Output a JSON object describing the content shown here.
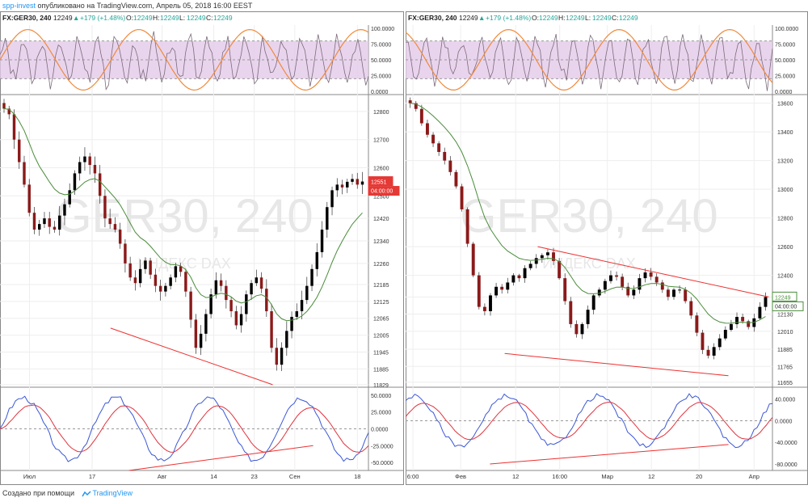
{
  "header": {
    "user": "spp-invest",
    "published": " опубликовано на TradingView.com, Апрель 05, 2018 16:00 EEST"
  },
  "footer": {
    "created": "Создано при помощи",
    "brand": "TradingView"
  },
  "colors": {
    "bull": "#000000",
    "bear": "#8b1a1a",
    "ma": "#4a8c3a",
    "stochK": "#7b6b7b",
    "stochD": "#f08a3a",
    "macd": "#3b57d6",
    "signal": "#e0333d",
    "trend": "#ee3030",
    "band": "#e3c9e8",
    "watermark": "#e7e7e7",
    "priceTag": "#e53935",
    "priceTag2": "#4a8c3a"
  },
  "charts": [
    {
      "symbol": "FX:GER30, 240",
      "quote": {
        "o": "12249",
        "h": "12249",
        "l": "12249",
        "c": "12249",
        "change": "+179 (+1.48%)"
      },
      "watermark": "GER30, 240",
      "watermark2": "ИНДЕКС DAX",
      "price_labels": [
        "12800",
        "12700",
        "12600",
        "12500",
        "12420",
        "12340",
        "12260",
        "12185",
        "12125",
        "12065",
        "12005",
        "11945",
        "11885",
        "11829"
      ],
      "price_values": [
        12800,
        12700,
        12600,
        12500,
        12420,
        12340,
        12260,
        12185,
        12125,
        12065,
        12005,
        11945,
        11885,
        11829
      ],
      "stoch_labels": [
        "100.0000",
        "75.0000",
        "50.0000",
        "25.0000",
        "0.0000"
      ],
      "macd_labels": [
        "50.0000",
        "25.0000",
        "0.0000",
        "-25.0000",
        "-50.0000"
      ],
      "macd_values": [
        50,
        25,
        0,
        -25,
        -50
      ],
      "macd_range": [
        -62,
        62
      ],
      "time_labels": [
        "Июл",
        "17",
        "Авг",
        "14",
        "23",
        "Сен",
        "18"
      ],
      "time_pos": [
        0.08,
        0.25,
        0.44,
        0.58,
        0.69,
        0.8,
        0.97
      ],
      "last_price": "12551",
      "last_value": 12551,
      "countdown": "04:00:00",
      "price_range": [
        11820,
        12860
      ],
      "closes": [
        12810,
        12790,
        12700,
        12620,
        12540,
        12440,
        12380,
        12400,
        12420,
        12390,
        12380,
        12430,
        12470,
        12520,
        12580,
        12620,
        12640,
        12610,
        12580,
        12500,
        12420,
        12400,
        12380,
        12330,
        12260,
        12210,
        12190,
        12240,
        12270,
        12220,
        12180,
        12160,
        12180,
        12210,
        12250,
        12230,
        12160,
        12060,
        11960,
        12010,
        12080,
        12150,
        12200,
        12180,
        12130,
        12090,
        12040,
        12080,
        12150,
        12190,
        12210,
        12170,
        12090,
        11960,
        11900,
        11960,
        12020,
        12070,
        12090,
        12130,
        12180,
        12240,
        12300,
        12380,
        12460,
        12520,
        12540,
        12530,
        12550,
        12560,
        12540,
        12551
      ],
      "price_trend": [
        [
          12030,
          0.3
        ],
        [
          11829,
          0.74
        ]
      ],
      "macd_trend": [
        [
          -62,
          0.35
        ],
        [
          -25,
          0.85
        ]
      ]
    },
    {
      "symbol": "FX:GER30, 240",
      "quote": {
        "o": "12249",
        "h": "12249",
        "l": "12249",
        "c": "12249",
        "change": "+179 (+1.48%)"
      },
      "watermark": "GER30, 240",
      "watermark2": "ИНДЕКС DAX",
      "price_labels": [
        "13600",
        "13400",
        "13200",
        "13000",
        "12800",
        "12600",
        "12400",
        "12249",
        "12130",
        "12010",
        "11885",
        "11765",
        "11655"
      ],
      "price_values": [
        13600,
        13400,
        13200,
        13000,
        12800,
        12600,
        12400,
        12249,
        12130,
        12010,
        11885,
        11765,
        11655
      ],
      "stoch_labels": [
        "100.0000",
        "75.0000",
        "50.0000",
        "25.0000",
        "0.0000"
      ],
      "macd_labels": [
        "40.0000",
        "0.0000",
        "-40.0000",
        "-80.0000"
      ],
      "macd_values": [
        40,
        0,
        -40,
        -80
      ],
      "macd_range": [
        -92,
        62
      ],
      "time_labels": [
        "6:00",
        "Фев",
        "12",
        "16:00",
        "Мар",
        "12",
        "20",
        "Апр"
      ],
      "time_pos": [
        0.02,
        0.15,
        0.3,
        0.42,
        0.55,
        0.67,
        0.8,
        0.95
      ],
      "last_price": "12249",
      "last_value": 12249,
      "countdown": "04:00:00",
      "price_range": [
        11620,
        13660
      ],
      "closes": [
        13600,
        13560,
        13460,
        13380,
        13320,
        13260,
        13200,
        13120,
        13020,
        12860,
        12620,
        12400,
        12180,
        12150,
        12260,
        12320,
        12300,
        12350,
        12400,
        12380,
        12450,
        12480,
        12520,
        12540,
        12560,
        12500,
        12380,
        12220,
        12060,
        11990,
        12060,
        12160,
        12260,
        12300,
        12360,
        12400,
        12390,
        12320,
        12260,
        12300,
        12380,
        12420,
        12390,
        12350,
        12300,
        12250,
        12300,
        12300,
        12220,
        12120,
        12000,
        11880,
        11840,
        11900,
        11960,
        12020,
        12060,
        12110,
        12080,
        12040,
        12100,
        12180,
        12249
      ],
      "price_trend": [
        [
          12600,
          0.36
        ],
        [
          12249,
          0.99
        ]
      ],
      "price_trend2": [
        [
          11855,
          0.27
        ],
        [
          11700,
          0.88
        ]
      ],
      "macd_trend": [
        [
          -80,
          0.23
        ],
        [
          -44,
          0.88
        ]
      ]
    }
  ]
}
